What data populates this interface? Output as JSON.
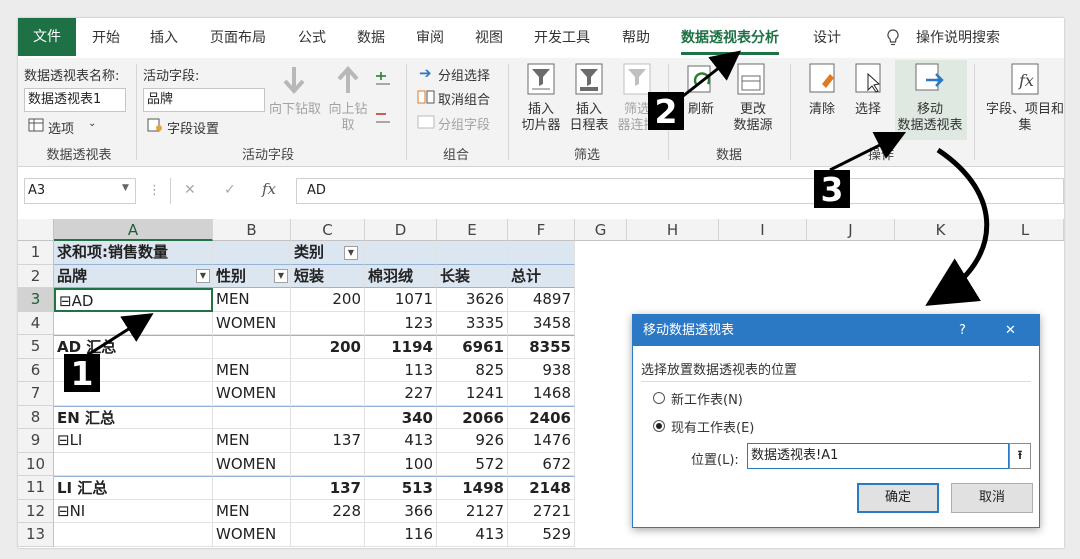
{
  "tabs": [
    "文件",
    "开始",
    "插入",
    "页面布局",
    "公式",
    "数据",
    "审阅",
    "视图",
    "开发工具",
    "帮助",
    "数据透视表分析",
    "设计"
  ],
  "tell_me": "操作说明搜索",
  "ribbon": {
    "pivot": {
      "name_label": "数据透视表名称:",
      "name_value": "数据透视表1",
      "options_label": "选项",
      "group_label": "数据透视表"
    },
    "active_field": {
      "label": "活动字段:",
      "value": "品牌",
      "settings_label": "字段设置",
      "drill_down": "向下钻取",
      "drill_up": "向上钻",
      "drill_up2": "取",
      "group_label": "活动字段"
    },
    "group": {
      "group_selection": "分组选择",
      "ungroup": "取消组合",
      "group_field": "分组字段",
      "group_label": "组合"
    },
    "filter": {
      "slicer1": "插入",
      "slicer2": "切片器",
      "timeline1": "插入",
      "timeline2": "日程表",
      "conn1": "筛选",
      "conn2": "器连接",
      "group_label": "筛选"
    },
    "data": {
      "refresh": "刷新",
      "change1": "更改",
      "change2": "数据源",
      "group_label": "数据"
    },
    "actions": {
      "clear": "清除",
      "select": "选择",
      "move1": "移动",
      "move2": "数据透视表",
      "group_label": "操作"
    },
    "calc": {
      "fields1": "字段、项目和",
      "fields2": "集"
    }
  },
  "formula_bar": {
    "name_box": "A3",
    "fx": "fx",
    "value": "AD"
  },
  "columns": [
    "A",
    "B",
    "C",
    "D",
    "E",
    "F",
    "G",
    "H",
    "I",
    "J",
    "K",
    "L"
  ],
  "rows": [
    "1",
    "2",
    "3",
    "4",
    "5",
    "6",
    "7",
    "8",
    "9",
    "10",
    "11",
    "12",
    "13"
  ],
  "cells": {
    "r1": {
      "a": "求和项:销售数量",
      "c": "类别"
    },
    "r2": {
      "a": "品牌",
      "b": "性别",
      "c": "短装",
      "d": "棉羽绒",
      "e": "长装",
      "f": "总计"
    },
    "r3": {
      "a": "⊟AD",
      "b": "MEN",
      "c": "200",
      "d": "1071",
      "e": "3626",
      "f": "4897"
    },
    "r4": {
      "b": "WOMEN",
      "d": "123",
      "e": "3335",
      "f": "3458"
    },
    "r5": {
      "a": "AD 汇总",
      "c": "200",
      "d": "1194",
      "e": "6961",
      "f": "8355"
    },
    "r6": {
      "b": "MEN",
      "d": "113",
      "e": "825",
      "f": "938"
    },
    "r7": {
      "b": "WOMEN",
      "d": "227",
      "e": "1241",
      "f": "1468"
    },
    "r8": {
      "a": "EN 汇总",
      "d": "340",
      "e": "2066",
      "f": "2406"
    },
    "r9": {
      "a": "⊟LI",
      "b": "MEN",
      "c": "137",
      "d": "413",
      "e": "926",
      "f": "1476"
    },
    "r10": {
      "b": "WOMEN",
      "d": "100",
      "e": "572",
      "f": "672"
    },
    "r11": {
      "a": "LI 汇总",
      "c": "137",
      "d": "513",
      "e": "1498",
      "f": "2148"
    },
    "r12": {
      "a": "⊟NI",
      "b": "MEN",
      "c": "228",
      "d": "366",
      "e": "2127",
      "f": "2721"
    },
    "r13": {
      "b": "WOMEN",
      "d": "116",
      "e": "413",
      "f": "529"
    }
  },
  "dialog": {
    "title": "移动数据透视表",
    "help": "?",
    "close": "✕",
    "prompt": "选择放置数据透视表的位置",
    "option_new": "新工作表(N)",
    "option_existing": "现有工作表(E)",
    "location_label": "位置(L):",
    "location_value": "数据透视表!A1",
    "ok": "确定",
    "cancel": "取消"
  },
  "markers": [
    "1",
    "2",
    "3"
  ]
}
